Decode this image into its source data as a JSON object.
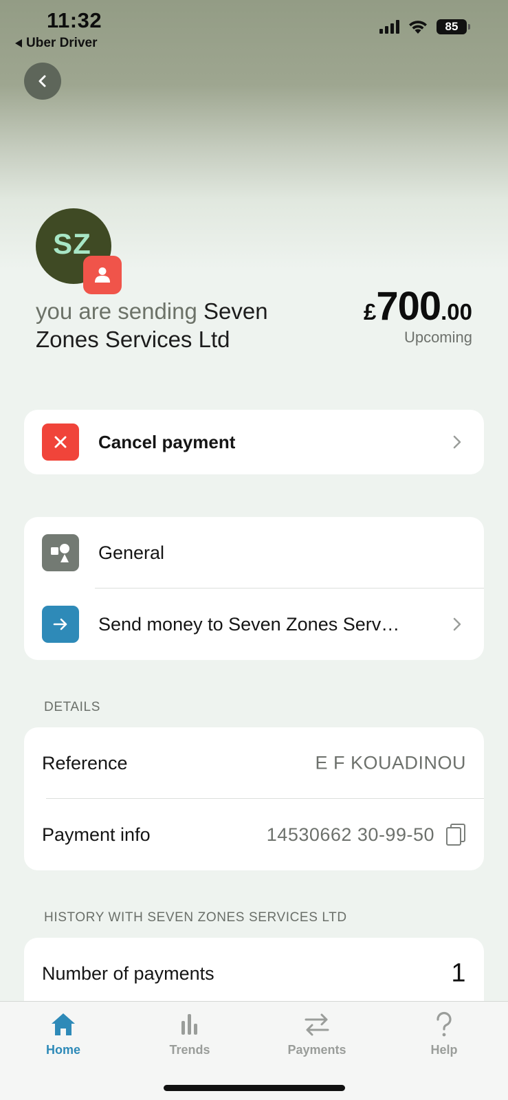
{
  "status_bar": {
    "time": "11:32",
    "back_app": "Uber Driver",
    "battery": "85"
  },
  "header": {
    "avatar_initials": "SZ",
    "sending_prefix": "you are sending",
    "recipient": "Seven Zones Services Ltd",
    "amount_currency": "£",
    "amount_main": "700",
    "amount_decimal": ".00",
    "amount_status": "Upcoming"
  },
  "actions": {
    "cancel_label": "Cancel payment"
  },
  "links": {
    "general_label": "General",
    "send_label": "Send money to Seven Zones Serv…"
  },
  "details": {
    "title": "DETAILS",
    "reference_label": "Reference",
    "reference_value": "E F KOUADINOU",
    "payment_info_label": "Payment info",
    "payment_info_value": "14530662 30-99-50"
  },
  "history": {
    "title": "HISTORY WITH SEVEN ZONES SERVICES LTD",
    "payments_label": "Number of payments",
    "payments_value": "1"
  },
  "tabs": [
    {
      "label": "Home",
      "icon": "home-icon",
      "active": true
    },
    {
      "label": "Trends",
      "icon": "bar-chart-icon",
      "active": false
    },
    {
      "label": "Payments",
      "icon": "transfer-arrows-icon",
      "active": false
    },
    {
      "label": "Help",
      "icon": "question-mark-icon",
      "active": false
    }
  ],
  "colors": {
    "accent": "#2e8ab8",
    "cancel_red": "#f0443a",
    "badge_red": "#f0544a",
    "avatar_bg": "#3f4a24",
    "avatar_text": "#a8e6c6",
    "general_icon_bg": "#737a73",
    "send_icon_bg": "#2e8ab8"
  }
}
